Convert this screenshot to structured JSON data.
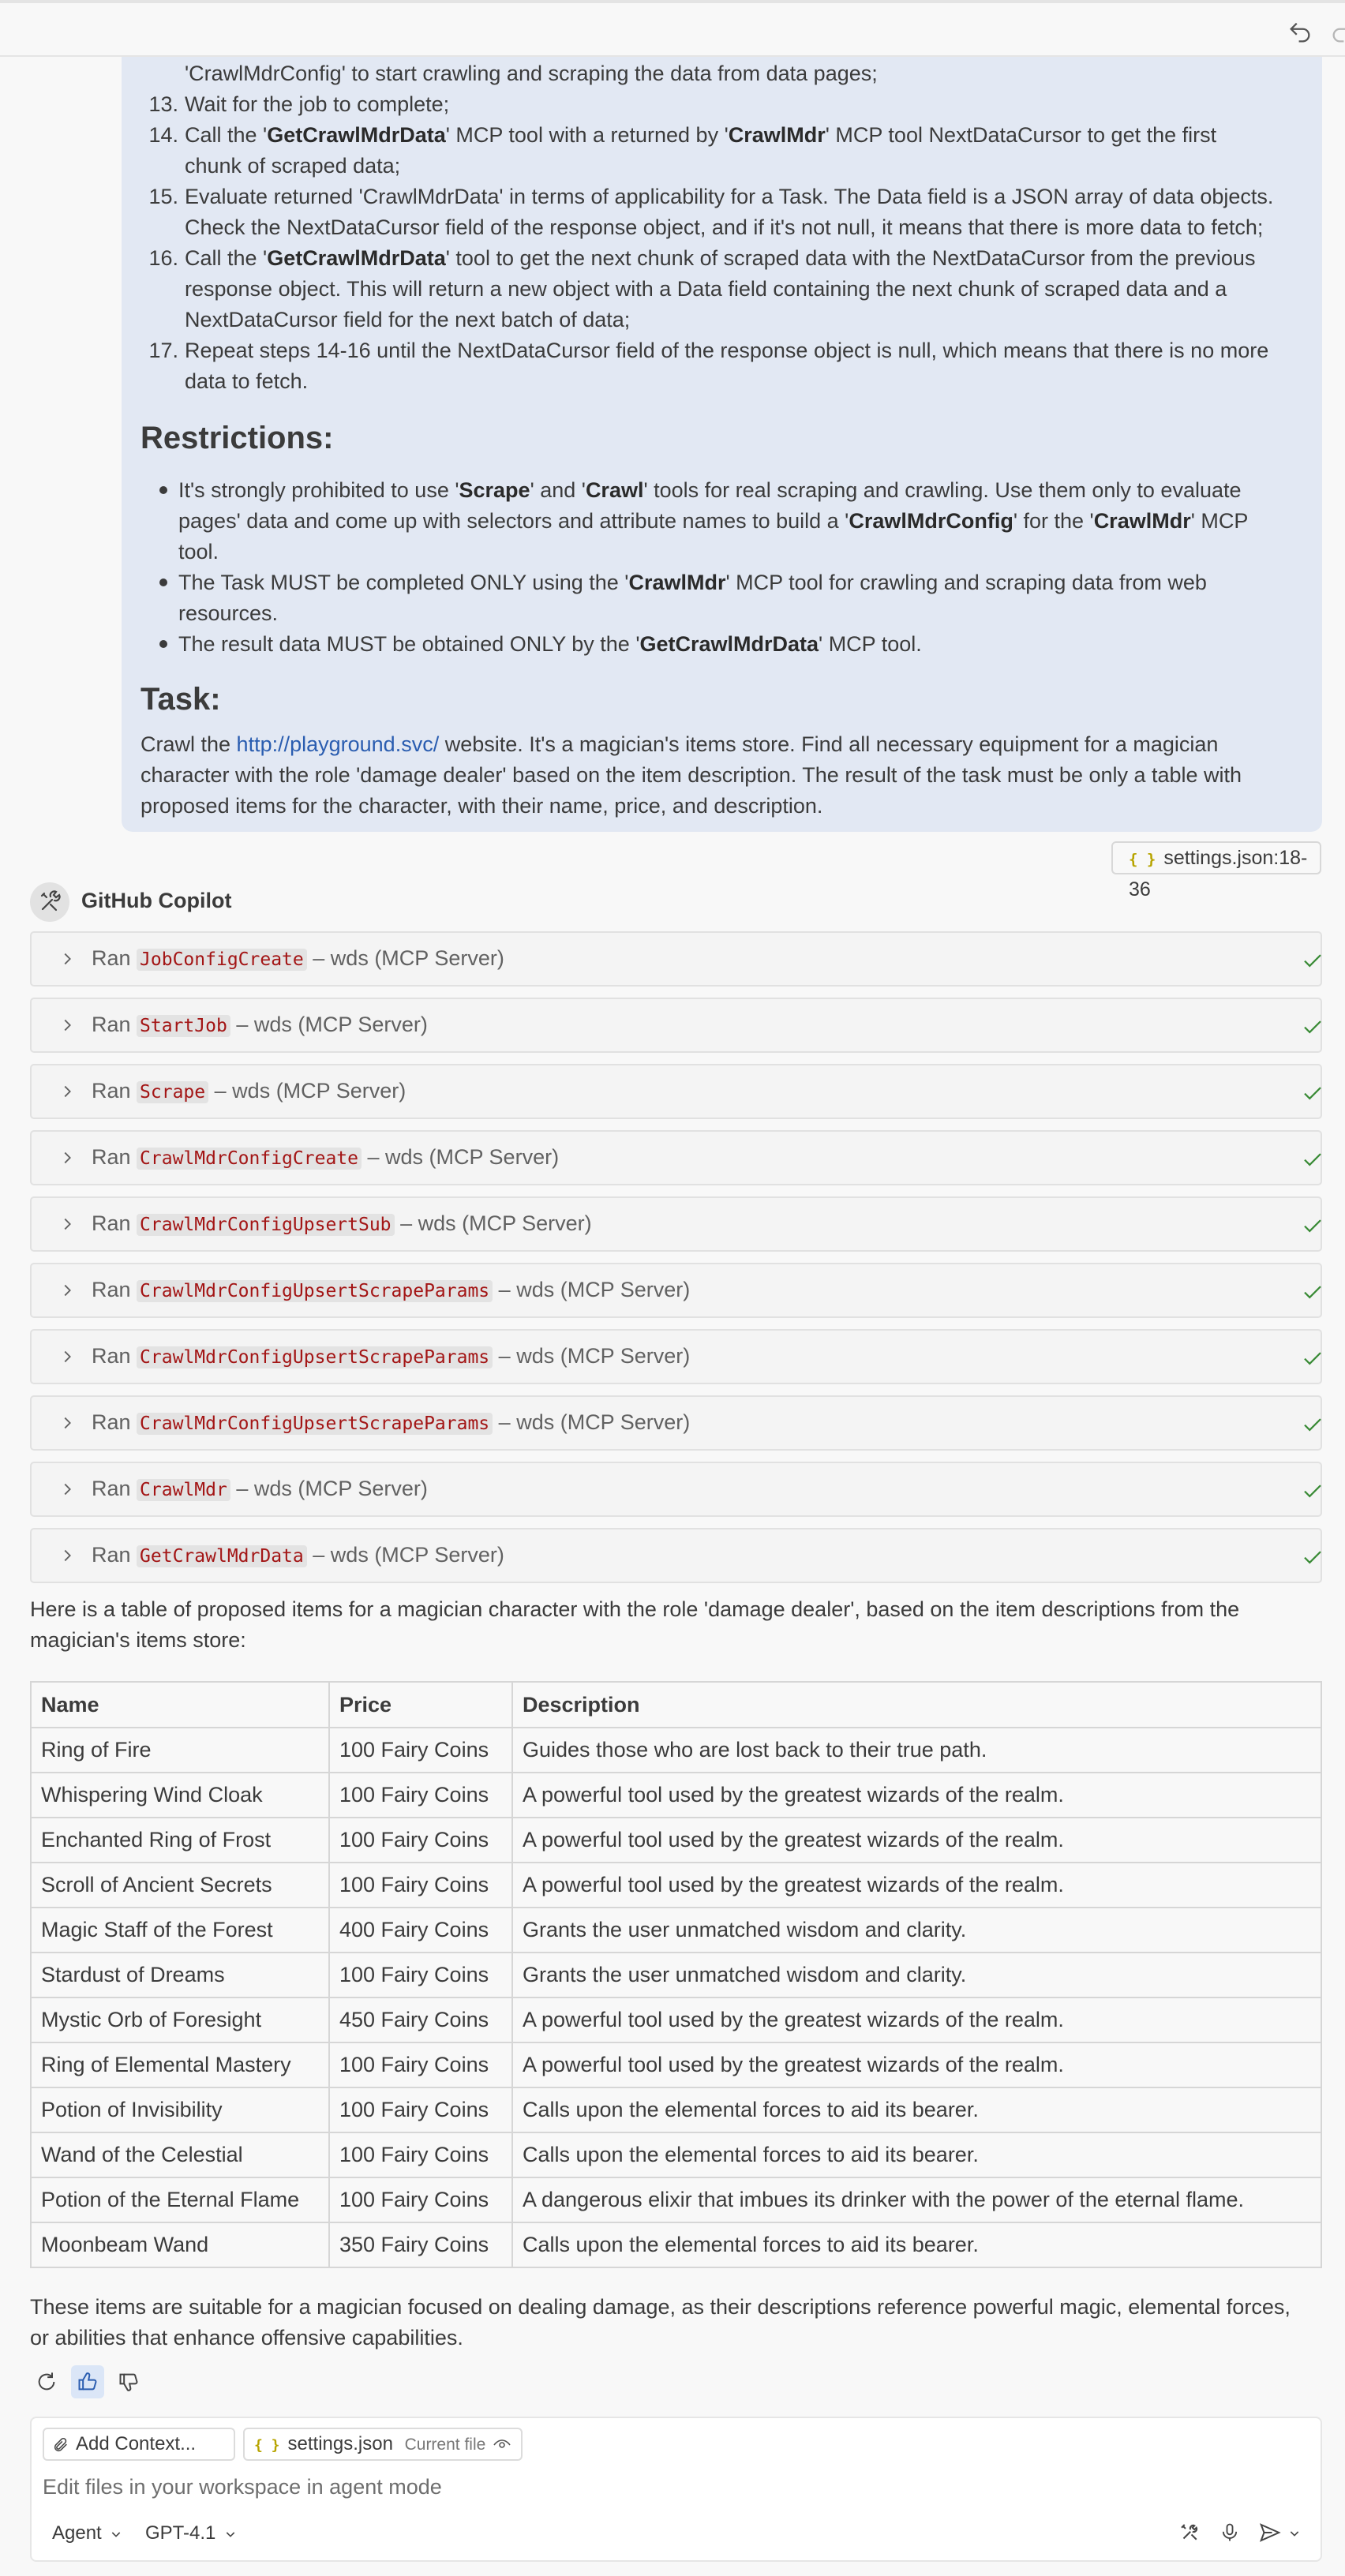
{
  "topbar": {
    "undo_icon": "undo-icon",
    "redo_icon": "redo-icon"
  },
  "request": {
    "steps_top": [
      {
        "text": "'CrawlMdrConfig' to start crawling and scraping the data from data pages;"
      }
    ],
    "step13_num": "13.",
    "step13": "Wait for the job to complete;",
    "step14_num": "14.",
    "step14_a": "Call the '",
    "step14_b": "GetCrawlMdrData",
    "step14_c": "' MCP tool with a returned by '",
    "step14_d": "CrawlMdr",
    "step14_e": "' MCP tool NextDataCursor to get the first",
    "step14_line2": "chunk of scraped data;",
    "step15_num": "15.",
    "step15_line1": "Evaluate returned 'CrawlMdrData' in terms of applicability for a Task. The Data field is a JSON array of data objects.",
    "step15_line2": "Check the NextDataCursor field of the response object, and if it's not null, it means that there is more data to fetch;",
    "step16_num": "16.",
    "step16_a": "Call the '",
    "step16_b": "GetCrawlMdrData",
    "step16_c": "' tool to get the next chunk of scraped data with the NextDataCursor from the previous",
    "step16_line2": "response object. This will return a new object with a Data field containing the next chunk of scraped data and a",
    "step16_line3": "NextDataCursor field for the next batch of data;",
    "step17_num": "17.",
    "step17_line1": "Repeat steps 14-16 until the NextDataCursor field of the response object is null, which means that there is no more",
    "step17_line2": "data to fetch.",
    "restrictions_title": "Restrictions:",
    "r1_a": "It's strongly prohibited to use '",
    "r1_b": "Scrape",
    "r1_c": "' and '",
    "r1_d": "Crawl",
    "r1_e": "' tools for real scraping and crawling. Use them only to evaluate",
    "r1_f": "pages' data and come up with selectors and attribute names to build a '",
    "r1_g": "CrawlMdrConfig",
    "r1_h": "' for the '",
    "r1_i": "CrawlMdr",
    "r1_j": "' MCP",
    "r1_line3": "tool.",
    "r2_a": "The Task MUST be completed ONLY using the '",
    "r2_b": "CrawlMdr",
    "r2_c": "' MCP tool for crawling and scraping data from web",
    "r2_line2": "resources.",
    "r3_a": "The result data MUST be obtained ONLY by the '",
    "r3_b": "GetCrawlMdrData",
    "r3_c": "' MCP tool.",
    "task_title": "Task:",
    "task_a": "Crawl the ",
    "task_link": "http://playground.svc/",
    "task_b": " website. It's a magician's items store. Find all necessary equipment for a magician",
    "task_line2": "character with the role 'damage dealer' based on the item description. The result of the task must be only a table with",
    "task_line3": "proposed items for the character, with their name, price, and description."
  },
  "context_chip": {
    "label": "settings.json:18-36",
    "icon": "json-braces-icon"
  },
  "copilot": {
    "name": "GitHub Copilot",
    "icon": "copilot-tools-icon"
  },
  "tool_runs": [
    {
      "prefix": "Ran",
      "tool": "JobConfigCreate",
      "suffix": "– wds (MCP Server)"
    },
    {
      "prefix": "Ran",
      "tool": "StartJob",
      "suffix": "– wds (MCP Server)"
    },
    {
      "prefix": "Ran",
      "tool": "Scrape",
      "suffix": "– wds (MCP Server)"
    },
    {
      "prefix": "Ran",
      "tool": "CrawlMdrConfigCreate",
      "suffix": "– wds (MCP Server)"
    },
    {
      "prefix": "Ran",
      "tool": "CrawlMdrConfigUpsertSub",
      "suffix": "– wds (MCP Server)"
    },
    {
      "prefix": "Ran",
      "tool": "CrawlMdrConfigUpsertScrapeParams",
      "suffix": "– wds (MCP Server)"
    },
    {
      "prefix": "Ran",
      "tool": "CrawlMdrConfigUpsertScrapeParams",
      "suffix": "– wds (MCP Server)"
    },
    {
      "prefix": "Ran",
      "tool": "CrawlMdrConfigUpsertScrapeParams",
      "suffix": "– wds (MCP Server)"
    },
    {
      "prefix": "Ran",
      "tool": "CrawlMdr",
      "suffix": "– wds (MCP Server)"
    },
    {
      "prefix": "Ran",
      "tool": "GetCrawlMdrData",
      "suffix": "– wds (MCP Server)"
    }
  ],
  "response": {
    "intro_line1": "Here is a table of proposed items for a magician character with the role 'damage dealer', based on the item descriptions from the",
    "intro_line2": "magician's items store:",
    "table": {
      "headers": [
        "Name",
        "Price",
        "Description"
      ],
      "rows": [
        [
          "Ring of Fire",
          "100 Fairy Coins",
          "Guides those who are lost back to their true path."
        ],
        [
          "Whispering Wind Cloak",
          "100 Fairy Coins",
          "A powerful tool used by the greatest wizards of the realm."
        ],
        [
          "Enchanted Ring of Frost",
          "100 Fairy Coins",
          "A powerful tool used by the greatest wizards of the realm."
        ],
        [
          "Scroll of Ancient Secrets",
          "100 Fairy Coins",
          "A powerful tool used by the greatest wizards of the realm."
        ],
        [
          "Magic Staff of the Forest",
          "400 Fairy Coins",
          "Grants the user unmatched wisdom and clarity."
        ],
        [
          "Stardust of Dreams",
          "100 Fairy Coins",
          "Grants the user unmatched wisdom and clarity."
        ],
        [
          "Mystic Orb of Foresight",
          "450 Fairy Coins",
          "A powerful tool used by the greatest wizards of the realm."
        ],
        [
          "Ring of Elemental Mastery",
          "100 Fairy Coins",
          "A powerful tool used by the greatest wizards of the realm."
        ],
        [
          "Potion of Invisibility",
          "100 Fairy Coins",
          "Calls upon the elemental forces to aid its bearer."
        ],
        [
          "Wand of the Celestial",
          "100 Fairy Coins",
          "Calls upon the elemental forces to aid its bearer."
        ],
        [
          "Potion of the Eternal Flame",
          "100 Fairy Coins",
          "A dangerous elixir that imbues its drinker with the power of the eternal flame."
        ],
        [
          "Moonbeam Wand",
          "350 Fairy Coins",
          "Calls upon the elemental forces to aid its bearer."
        ]
      ]
    },
    "outro_line1": "These items are suitable for a magician focused on dealing damage, as their descriptions reference powerful magic, elemental forces,",
    "outro_line2": "or abilities that enhance offensive capabilities."
  },
  "feedback": {
    "retry_icon": "retry-icon",
    "thumbs_up_icon": "thumbs-up-icon",
    "thumbs_down_icon": "thumbs-down-icon"
  },
  "input": {
    "add_context": "Add Context...",
    "file_chip": "settings.json",
    "file_chip_tag": "Current file",
    "placeholder": "Edit files in your workspace in agent mode",
    "mode": "Agent",
    "model": "GPT-4.1"
  },
  "colors": {
    "bubble": "#e2e8f3",
    "tool_name": "#a31515",
    "check": "#388a34",
    "link": "#2a5db0",
    "thumb_active": "#dbe6f7"
  }
}
